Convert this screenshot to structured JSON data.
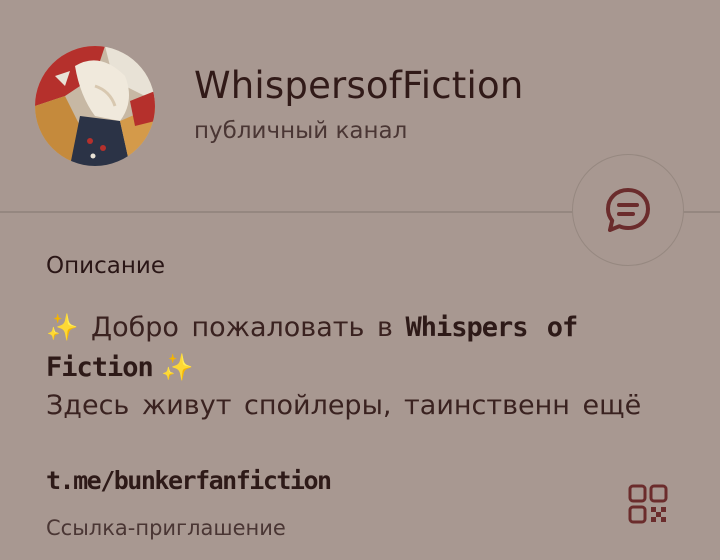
{
  "channel": {
    "name": "WhispersofFiction",
    "type_label": "публичный канал"
  },
  "description": {
    "section_title": "Описание",
    "line1_prefix": "Добро пожаловать в",
    "line1_deco": "Whispers of",
    "line2_deco": "Fiction",
    "line3_text": "Здесь живут спойлеры, таинственн",
    "line3_after": "ещё",
    "sparkle": "✨"
  },
  "invite": {
    "link": "t.me/bunkerfanfiction",
    "caption": "Ссылка-приглашение"
  },
  "icons": {
    "fab": "chat-bubble-icon",
    "qr": "qr-code-icon"
  },
  "colors": {
    "background": "#a89891",
    "text": "#311a18",
    "secondary": "#4a3634",
    "accent": "#6b2c2c",
    "sparkle": "#e8c04a"
  }
}
